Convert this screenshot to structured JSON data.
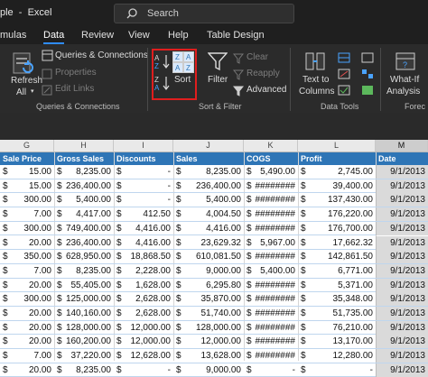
{
  "titlebar": {
    "title": "ple  -  Excel",
    "search_placeholder": "Search"
  },
  "tabs": [
    "mulas",
    "Data",
    "Review",
    "View",
    "Help",
    "Table Design"
  ],
  "active_tab": "Data",
  "ribbon": {
    "refresh_all": [
      "Refresh",
      "All"
    ],
    "queries_connections": "Queries & Connections",
    "properties": "Properties",
    "edit_links": "Edit Links",
    "group_queries": "Queries & Connections",
    "sort": "Sort",
    "filter": "Filter",
    "clear": "Clear",
    "reapply": "Reapply",
    "advanced": "Advanced",
    "group_sort_filter": "Sort & Filter",
    "text_to_columns": [
      "Text to",
      "Columns"
    ],
    "group_data_tools": "Data Tools",
    "what_if": [
      "What-If",
      "Analysis"
    ],
    "group_forecast": "Forec"
  },
  "sheet": {
    "col_letters": [
      "G",
      "H",
      "I",
      "J",
      "K",
      "L",
      "M"
    ],
    "selected_col": "M",
    "headers": [
      "Sale Price",
      "Gross Sales",
      "Discounts",
      "Sales",
      "COGS",
      "Profit",
      "Date"
    ],
    "currency": "$",
    "rows": [
      [
        "15.00",
        "8,235.00",
        "-",
        "8,235.00",
        "5,490.00",
        "2,745.00",
        "9/1/2013"
      ],
      [
        "15.00",
        "236,400.00",
        "-",
        "236,400.00",
        "########",
        "39,400.00",
        "9/1/2013"
      ],
      [
        "300.00",
        "5,400.00",
        "-",
        "5,400.00",
        "########",
        "137,430.00",
        "9/1/2013"
      ],
      [
        "7.00",
        "4,417.00",
        "412.50",
        "4,004.50",
        "########",
        "176,220.00",
        "9/1/2013"
      ],
      [
        "300.00",
        "749,400.00",
        "4,416.00",
        "4,416.00",
        "########",
        "176,700.00",
        "9/1/2013"
      ],
      [
        "20.00",
        "236,400.00",
        "4,416.00",
        "23,629.32",
        "5,967.00",
        "17,662.32",
        "9/1/2013"
      ],
      [
        "350.00",
        "628,950.00",
        "18,868.50",
        "610,081.50",
        "########",
        "142,861.50",
        "9/1/2013"
      ],
      [
        "7.00",
        "8,235.00",
        "2,228.00",
        "9,000.00",
        "5,400.00",
        "6,771.00",
        "9/1/2013"
      ],
      [
        "20.00",
        "55,405.00",
        "1,628.00",
        "6,295.80",
        "########",
        "5,371.00",
        "9/1/2013"
      ],
      [
        "300.00",
        "125,000.00",
        "2,628.00",
        "35,870.00",
        "########",
        "35,348.00",
        "9/1/2013"
      ],
      [
        "20.00",
        "140,160.00",
        "2,628.00",
        "51,740.00",
        "########",
        "51,735.00",
        "9/1/2013"
      ],
      [
        "20.00",
        "128,000.00",
        "12,000.00",
        "128,000.00",
        "########",
        "76,210.00",
        "9/1/2013"
      ],
      [
        "20.00",
        "160,200.00",
        "12,000.00",
        "12,000.00",
        "########",
        "13,170.00",
        "9/1/2013"
      ],
      [
        "7.00",
        "37,220.00",
        "12,628.00",
        "13,628.00",
        "########",
        "12,280.00",
        "9/1/2013"
      ],
      [
        "20.00",
        "8,235.00",
        "-",
        "9,000.00",
        "-",
        "-",
        "9/1/2013"
      ]
    ]
  }
}
